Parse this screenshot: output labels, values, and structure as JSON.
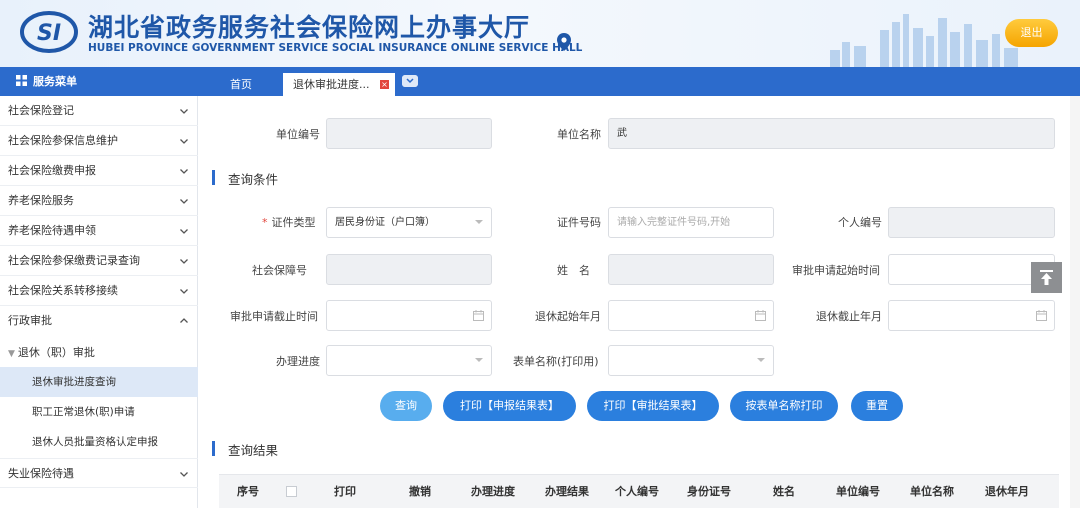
{
  "header": {
    "title_cn": "湖北省政务服务社会保险网上办事大厅",
    "title_en": "HUBEI PROVINCE GOVERNMENT SERVICE SOCIAL INSURANCE ONLINE SERVICE HALL",
    "logo_text": "SI",
    "logout_label": "退出"
  },
  "nav": {
    "menu_title": "服务菜单",
    "tabs": [
      {
        "label": "首页"
      },
      {
        "label": "退休审批进度..."
      }
    ],
    "close_glyph": "×"
  },
  "sidebar": {
    "items": [
      {
        "label": "社会保险登记"
      },
      {
        "label": "社会保险参保信息维护"
      },
      {
        "label": "社会保险缴费申报"
      },
      {
        "label": "养老保险服务"
      },
      {
        "label": "养老保险待遇申领"
      },
      {
        "label": "社会保险参保缴费记录查询"
      },
      {
        "label": "社会保险关系转移接续"
      },
      {
        "label": "行政审批"
      }
    ],
    "group": {
      "label": "退休（职）审批"
    },
    "sub_items": [
      {
        "label": "退休审批进度查询"
      },
      {
        "label": "职工正常退休(职)申请"
      },
      {
        "label": "退休人员批量资格认定申报"
      }
    ],
    "last_item": {
      "label": "失业保险待遇"
    }
  },
  "form": {
    "unit_no_label": "单位编号",
    "unit_name_label": "单位名称",
    "unit_name_value": "武",
    "query_section": "查询条件",
    "id_type_label": "证件类型",
    "id_type_value": "居民身份证（户口簿）",
    "id_no_label": "证件号码",
    "id_no_placeholder": "请输入完整证件号码,开始",
    "personal_no_label": "个人编号",
    "ss_no_label": "社会保障号",
    "name_label": "姓　名",
    "approve_start_label": "审批申请起始时间",
    "approve_end_label": "审批申请截止时间",
    "retire_start_label": "退休起始年月",
    "retire_end_label": "退休截止年月",
    "progress_label": "办理进度",
    "form_name_label": "表单名称(打印用)"
  },
  "buttons": {
    "query": "查询",
    "print_apply": "打印【申报结果表】",
    "print_approve": "打印【审批结果表】",
    "print_by_form": "按表单名称打印",
    "reset": "重置"
  },
  "results": {
    "section": "查询结果",
    "columns": [
      "序号",
      "打印",
      "撤销",
      "办理进度",
      "办理结果",
      "个人编号",
      "身份证号",
      "姓名",
      "单位编号",
      "单位名称",
      "退休年月"
    ]
  },
  "icons": {
    "logo": "si-logo-icon",
    "location": "location-pin-icon",
    "menu": "grid-icon",
    "back_to_top": "arrow-up-icon",
    "calendar": "calendar-icon",
    "dropdown": "chevron-down-icon"
  },
  "colors": {
    "brand_blue": "#2c6bcc",
    "logout_gold": "#f5a400",
    "button_blue": "#2b7fde",
    "button_light": "#58adee",
    "required_red": "#e2463d"
  }
}
